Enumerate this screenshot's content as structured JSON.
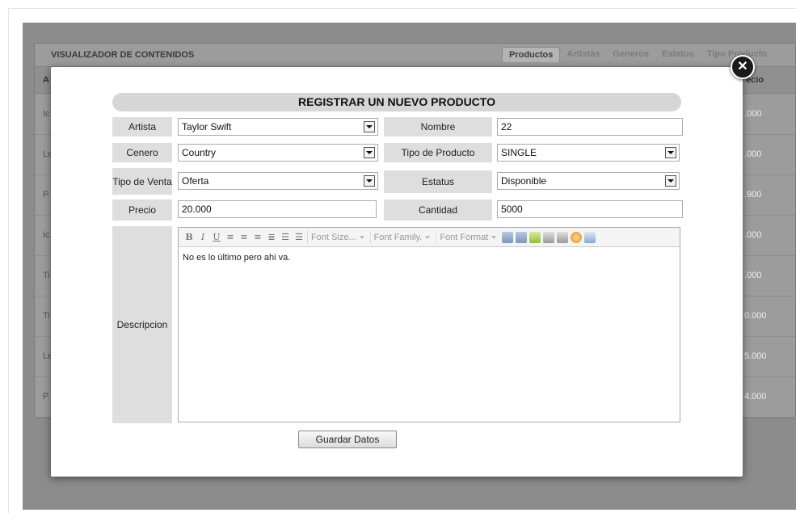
{
  "background": {
    "title": "VISUALIZADOR DE CONTENIDOS",
    "tabs": [
      "Productos",
      "Artistas",
      "Generos",
      "Estatus",
      "Tipo Producto"
    ],
    "column_a": "A",
    "column_precio": "ecio",
    "rows": [
      {
        "c1": "Ic",
        "c2": ".000"
      },
      {
        "c1": "Le",
        "c2": ".000"
      },
      {
        "c1": "P",
        "c2": ".900"
      },
      {
        "c1": "Ic",
        "c2": ".000"
      },
      {
        "c1": "Ti",
        "c2": ".000"
      },
      {
        "c1": "Ti",
        "c2": "0.000"
      },
      {
        "c1": "Le",
        "c2": "5.000"
      },
      {
        "c1": "P",
        "c2": "4.000"
      }
    ]
  },
  "modal": {
    "close_icon": "close-icon",
    "title": "REGISTRAR UN NUEVO PRODUCTO",
    "fields": {
      "artista": {
        "label": "Artista",
        "value": "Taylor Swift"
      },
      "nombre": {
        "label": "Nombre",
        "value": "22"
      },
      "genero": {
        "label": "Cenero",
        "value": "Country"
      },
      "tipo_producto": {
        "label": "Tipo de Producto",
        "value": "SINGLE"
      },
      "tipo_venta": {
        "label": "Tipo de Venta",
        "value": "Oferta"
      },
      "estatus": {
        "label": "Estatus",
        "value": "Disponible"
      },
      "precio": {
        "label": "Precio",
        "value": "20.000"
      },
      "cantidad": {
        "label": "Cantidad",
        "value": "5000"
      },
      "descripcion": {
        "label": "Descripcion"
      }
    },
    "editor": {
      "toolbar": {
        "bold": "B",
        "italic": "I",
        "underline": "U",
        "font_size": "Font Size...",
        "font_family": "Font Family.",
        "font_format": "Font Format"
      },
      "content": "No es lo último pero ahi va."
    },
    "save_label": "Guardar Datos"
  }
}
